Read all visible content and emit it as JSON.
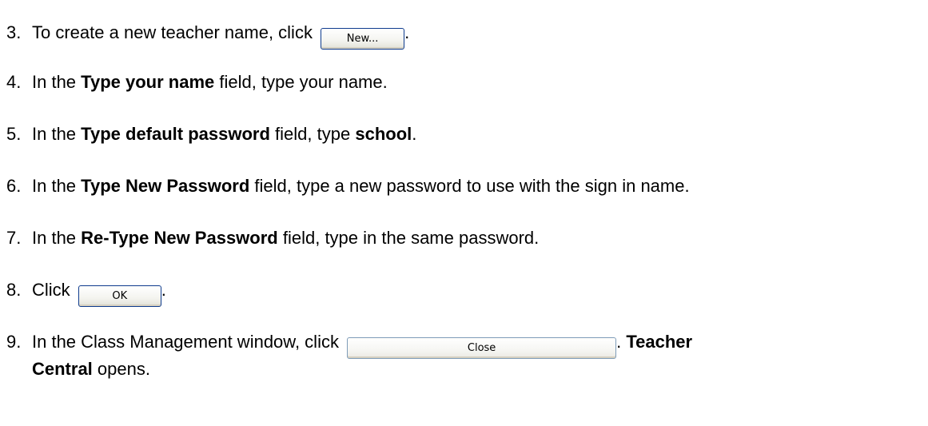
{
  "steps": [
    {
      "number": "3.",
      "text_before": "To create a new teacher name, click",
      "button_label": "New...",
      "text_after": "."
    },
    {
      "number": "4.",
      "text_before": "In the",
      "bold": "Type your name",
      "text_after": "field, type your name."
    },
    {
      "number": "5.",
      "text_before": "In the",
      "bold": "Type default password",
      "text_mid": "field, type",
      "bold2": "school",
      "text_after": "."
    },
    {
      "number": "6.",
      "text_before": "In the",
      "bold": "Type New Password",
      "text_after": "field, type a new password to use with the sign in name."
    },
    {
      "number": "7.",
      "text_before": "In the",
      "bold": "Re-Type New Password",
      "text_after": "field, type in the same password."
    },
    {
      "number": "8.",
      "text_before": "Click",
      "button_label": "OK",
      "text_after": "."
    },
    {
      "number": "9.",
      "text_before": "In the Class Management window, click",
      "button_label": "Close",
      "text_mid": ".",
      "bold": "Teacher",
      "bold_line2": "Central",
      "text_after": "opens."
    }
  ]
}
